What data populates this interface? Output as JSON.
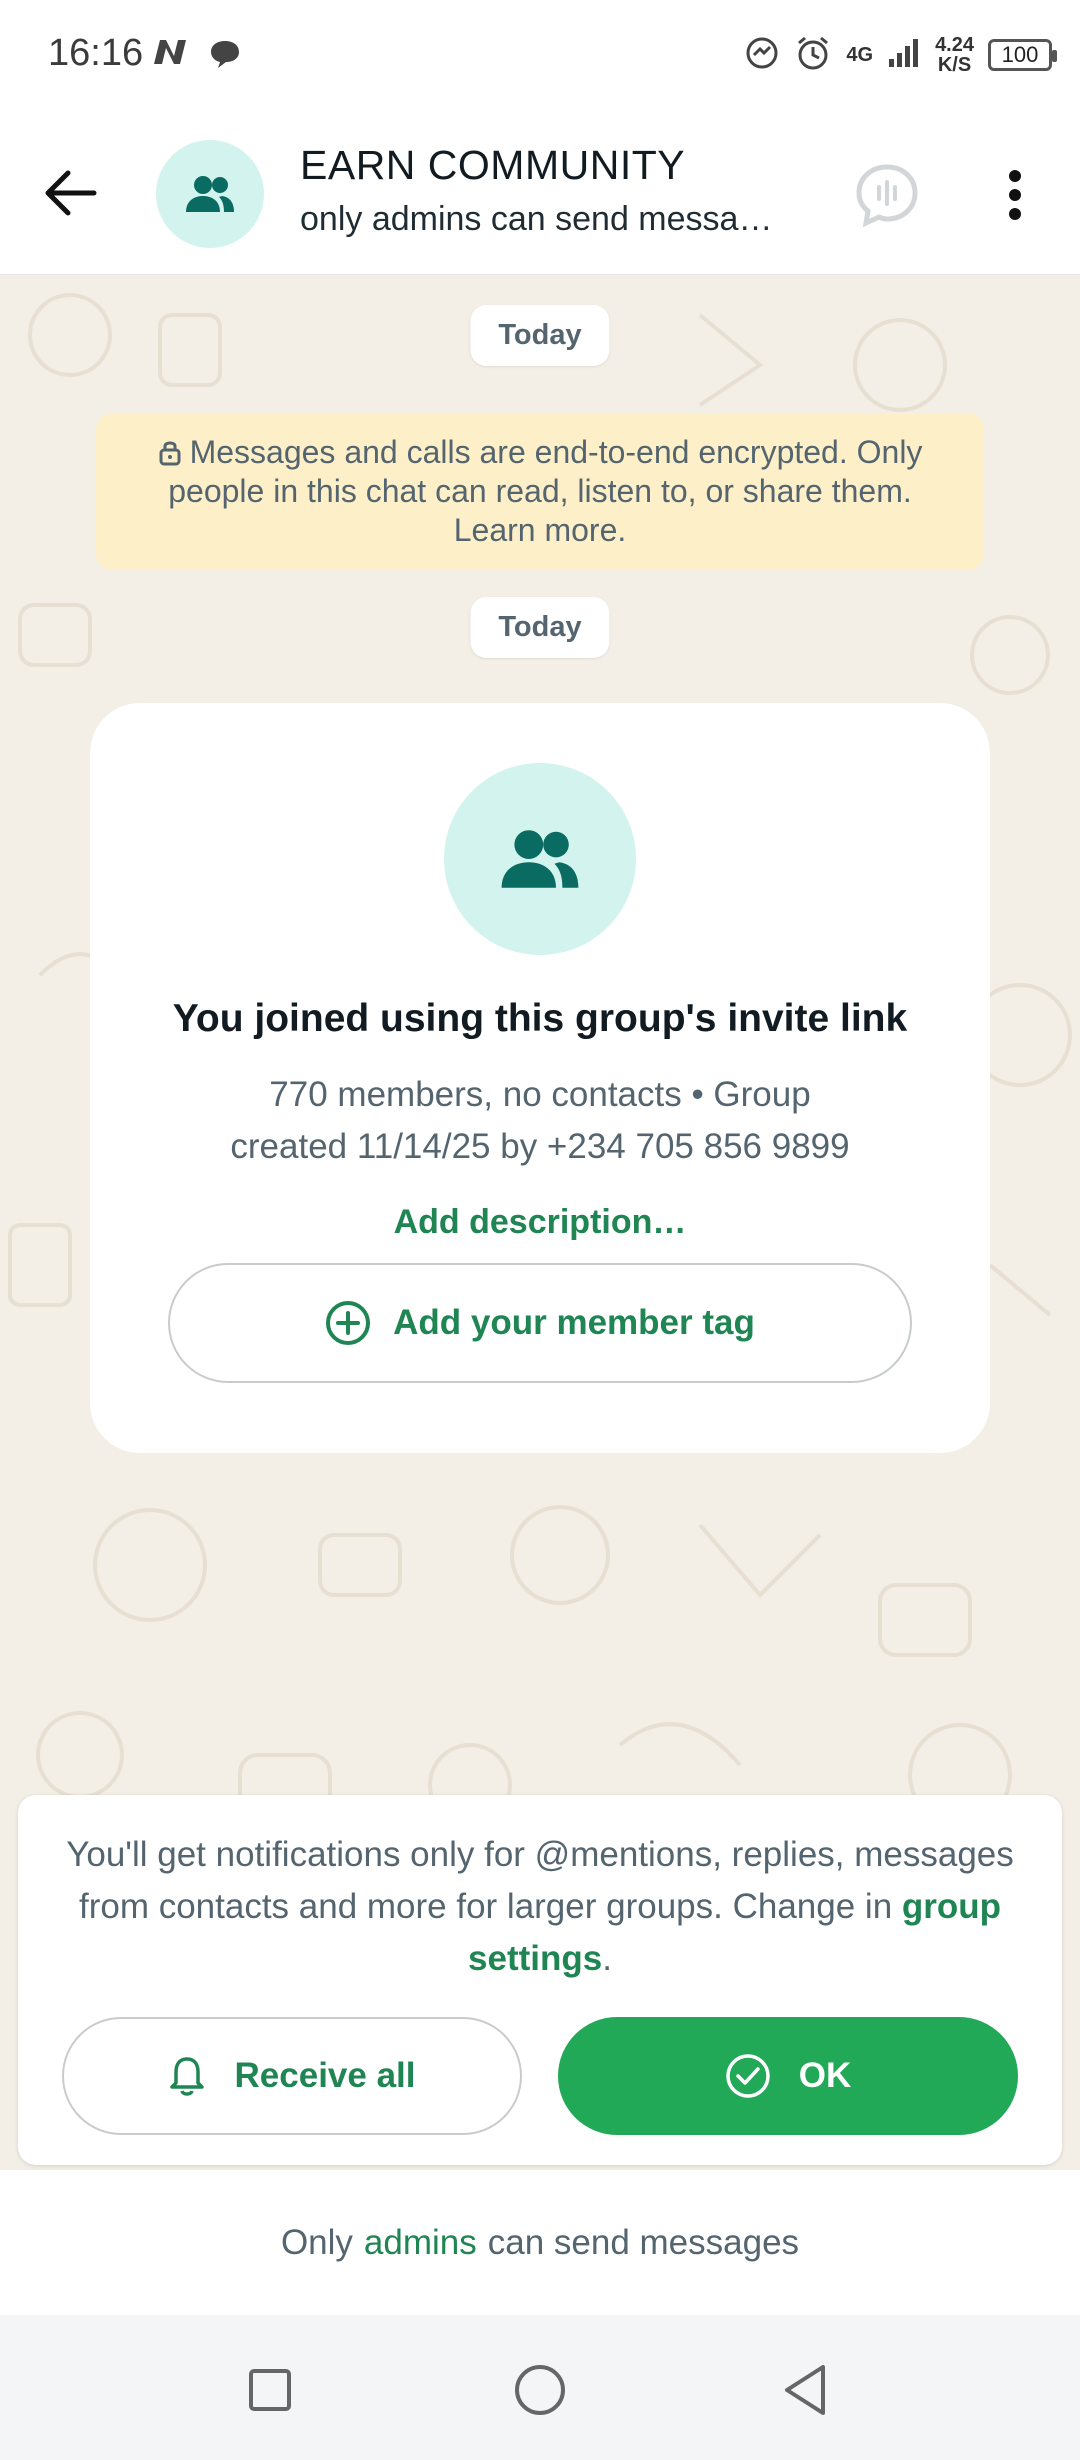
{
  "status_bar": {
    "time": "16:16",
    "network": "4G",
    "speed_value": "4.24",
    "speed_unit": "K/S",
    "battery": "100"
  },
  "header": {
    "title": "EARN COMMUNITY",
    "subtitle": "only admins can send messa…"
  },
  "chat": {
    "date_chip_1": "Today",
    "encryption_notice": "Messages and calls are end-to-end encrypted. Only people in this chat can read, listen to, or share them. Learn more.",
    "date_chip_2": "Today",
    "card": {
      "title": "You joined using this group's invite link",
      "meta_line1": "770 members, no contacts • Group",
      "meta_line2": "created 11/14/25 by +234 705 856 9899",
      "add_description": "Add description…",
      "member_tag_button": "Add your member tag"
    }
  },
  "notification": {
    "text_before": "You'll get notifications only for @mentions, replies, messages from contacts and more for larger groups. Change in",
    "link": "group settings",
    "text_after": ".",
    "receive_all": "Receive all",
    "ok": "OK"
  },
  "footer": {
    "before": "Only",
    "link": "admins",
    "after": "can send messages"
  },
  "colors": {
    "accent": "#1f8553",
    "ok_button": "#21a957",
    "chat_bg": "#f3eee6",
    "notice_bg": "#fdefc8",
    "avatar_bg": "#d3f3ee"
  }
}
